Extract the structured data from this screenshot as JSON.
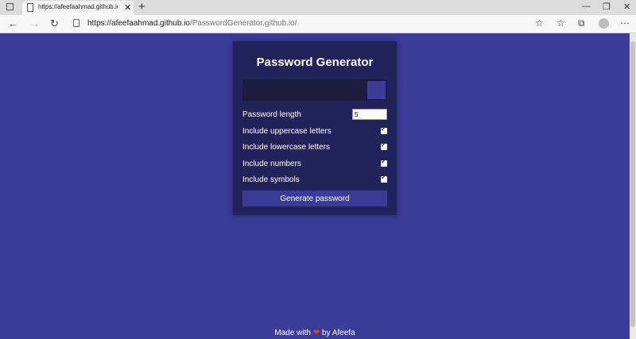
{
  "browser": {
    "tab_title": "https://afeefaahmad.github.io/Pa",
    "url_host": "https://afeefaahmad.github.io",
    "url_path": "/PasswordGenerator.github.io/"
  },
  "app": {
    "title": "Password Generator",
    "settings": [
      {
        "label": "Password length",
        "type": "number",
        "value": "5"
      },
      {
        "label": "Include uppercase letters",
        "type": "checkbox",
        "checked": true
      },
      {
        "label": "Include lowercase letters",
        "type": "checkbox",
        "checked": true
      },
      {
        "label": "Include numbers",
        "type": "checkbox",
        "checked": true
      },
      {
        "label": "Include symbols",
        "type": "checkbox",
        "checked": true
      }
    ],
    "generate_label": "Generate password"
  },
  "footer": {
    "prefix": "Made with ",
    "heart": "❤",
    "suffix": " by Afeefa"
  },
  "colors": {
    "background": "#3b3b98",
    "panel": "#23235b",
    "result": "#1c1c3c",
    "accent": "#3b3b98"
  }
}
